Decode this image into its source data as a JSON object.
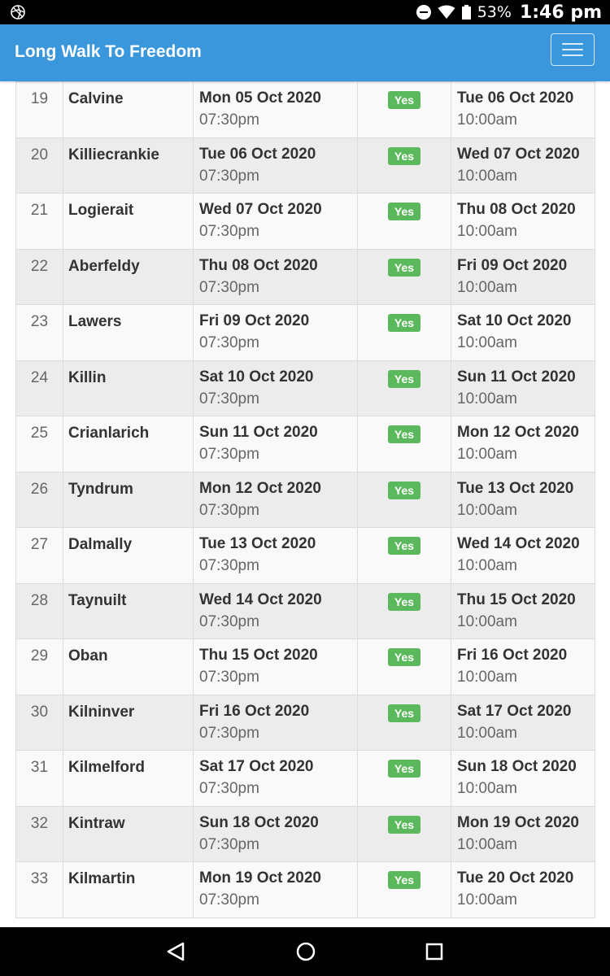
{
  "status_bar": {
    "battery_percent": "53%",
    "time": "1:46 pm"
  },
  "navbar": {
    "brand": "Long Walk To Freedom",
    "menu_icon": "hamburger-icon"
  },
  "table": {
    "rows": [
      {
        "num": "19",
        "place": "Calvine",
        "arrive_date": "Mon 05 Oct 2020",
        "arrive_time": "07:30pm",
        "status": "Yes",
        "depart_date": "Tue 06 Oct 2020",
        "depart_time": "10:00am"
      },
      {
        "num": "20",
        "place": "Killiecrankie",
        "arrive_date": "Tue 06 Oct 2020",
        "arrive_time": "07:30pm",
        "status": "Yes",
        "depart_date": "Wed 07 Oct 2020",
        "depart_time": "10:00am"
      },
      {
        "num": "21",
        "place": "Logierait",
        "arrive_date": "Wed 07 Oct 2020",
        "arrive_time": "07:30pm",
        "status": "Yes",
        "depart_date": "Thu 08 Oct 2020",
        "depart_time": "10:00am"
      },
      {
        "num": "22",
        "place": "Aberfeldy",
        "arrive_date": "Thu 08 Oct 2020",
        "arrive_time": "07:30pm",
        "status": "Yes",
        "depart_date": "Fri 09 Oct 2020",
        "depart_time": "10:00am"
      },
      {
        "num": "23",
        "place": "Lawers",
        "arrive_date": "Fri 09 Oct 2020",
        "arrive_time": "07:30pm",
        "status": "Yes",
        "depart_date": "Sat 10 Oct 2020",
        "depart_time": "10:00am"
      },
      {
        "num": "24",
        "place": "Killin",
        "arrive_date": "Sat 10 Oct 2020",
        "arrive_time": "07:30pm",
        "status": "Yes",
        "depart_date": "Sun 11 Oct 2020",
        "depart_time": "10:00am"
      },
      {
        "num": "25",
        "place": "Crianlarich",
        "arrive_date": "Sun 11 Oct 2020",
        "arrive_time": "07:30pm",
        "status": "Yes",
        "depart_date": "Mon 12 Oct 2020",
        "depart_time": "10:00am"
      },
      {
        "num": "26",
        "place": "Tyndrum",
        "arrive_date": "Mon 12 Oct 2020",
        "arrive_time": "07:30pm",
        "status": "Yes",
        "depart_date": "Tue 13 Oct 2020",
        "depart_time": "10:00am"
      },
      {
        "num": "27",
        "place": "Dalmally",
        "arrive_date": "Tue 13 Oct 2020",
        "arrive_time": "07:30pm",
        "status": "Yes",
        "depart_date": "Wed 14 Oct 2020",
        "depart_time": "10:00am"
      },
      {
        "num": "28",
        "place": "Taynuilt",
        "arrive_date": "Wed 14 Oct 2020",
        "arrive_time": "07:30pm",
        "status": "Yes",
        "depart_date": "Thu 15 Oct 2020",
        "depart_time": "10:00am"
      },
      {
        "num": "29",
        "place": "Oban",
        "arrive_date": "Thu 15 Oct 2020",
        "arrive_time": "07:30pm",
        "status": "Yes",
        "depart_date": "Fri 16 Oct 2020",
        "depart_time": "10:00am"
      },
      {
        "num": "30",
        "place": "Kilninver",
        "arrive_date": "Fri 16 Oct 2020",
        "arrive_time": "07:30pm",
        "status": "Yes",
        "depart_date": "Sat 17 Oct 2020",
        "depart_time": "10:00am"
      },
      {
        "num": "31",
        "place": "Kilmelford",
        "arrive_date": "Sat 17 Oct 2020",
        "arrive_time": "07:30pm",
        "status": "Yes",
        "depart_date": "Sun 18 Oct 2020",
        "depart_time": "10:00am"
      },
      {
        "num": "32",
        "place": "Kintraw",
        "arrive_date": "Sun 18 Oct 2020",
        "arrive_time": "07:30pm",
        "status": "Yes",
        "depart_date": "Mon 19 Oct 2020",
        "depart_time": "10:00am"
      },
      {
        "num": "33",
        "place": "Kilmartin",
        "arrive_date": "Mon 19 Oct 2020",
        "arrive_time": "07:30pm",
        "status": "Yes",
        "depart_date": "Tue 20 Oct 2020",
        "depart_time": "10:00am"
      }
    ]
  },
  "colors": {
    "navbar": "#3b97dc",
    "badge": "#5cb85c",
    "row_odd": "#f9f9f9",
    "row_even": "#ececec"
  },
  "nav_bar": {
    "icons": [
      "back-icon",
      "home-icon",
      "recents-icon"
    ]
  }
}
